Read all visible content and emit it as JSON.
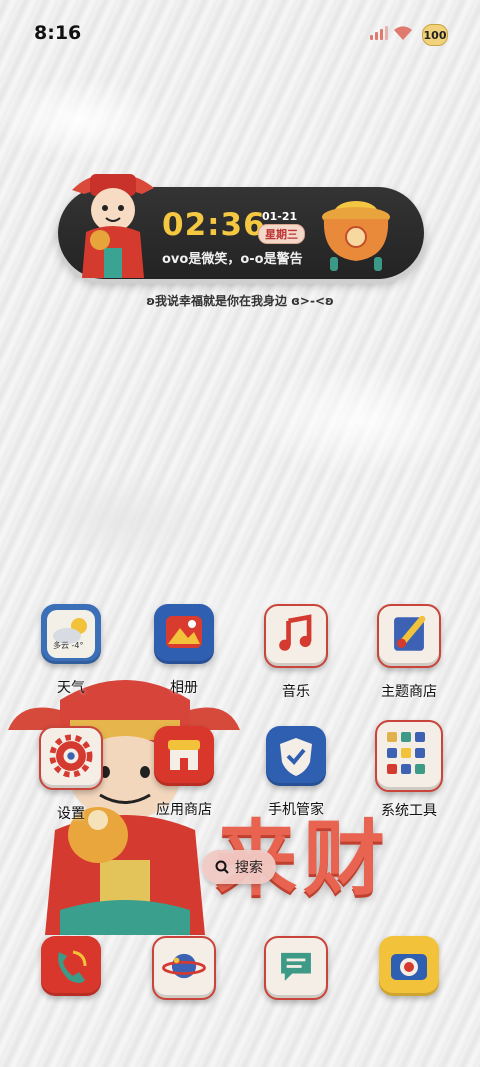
{
  "status_bar": {
    "time": "8:16",
    "battery": "100"
  },
  "widget": {
    "clock": "02:36",
    "date": "01-21",
    "weekday": "星期三",
    "motto": "ovo是微笑，o-o是警告",
    "tagline": "ʚ我说幸福就是你在我身边 ɞ>-<ʚ"
  },
  "wallpaper": {
    "calligraphy": "来财"
  },
  "apps": {
    "weather": {
      "label": "天气",
      "badge": "多云 -4°"
    },
    "gallery": {
      "label": "相册"
    },
    "music": {
      "label": "音乐"
    },
    "themes": {
      "label": "主题商店"
    },
    "settings": {
      "label": "设置"
    },
    "app_store": {
      "label": "应用商店"
    },
    "phone_manager": {
      "label": "手机管家"
    },
    "system_tools": {
      "label": "系统工具"
    }
  },
  "search": {
    "label": "搜索"
  },
  "dock": [
    "phone",
    "browser",
    "messages",
    "camera"
  ]
}
